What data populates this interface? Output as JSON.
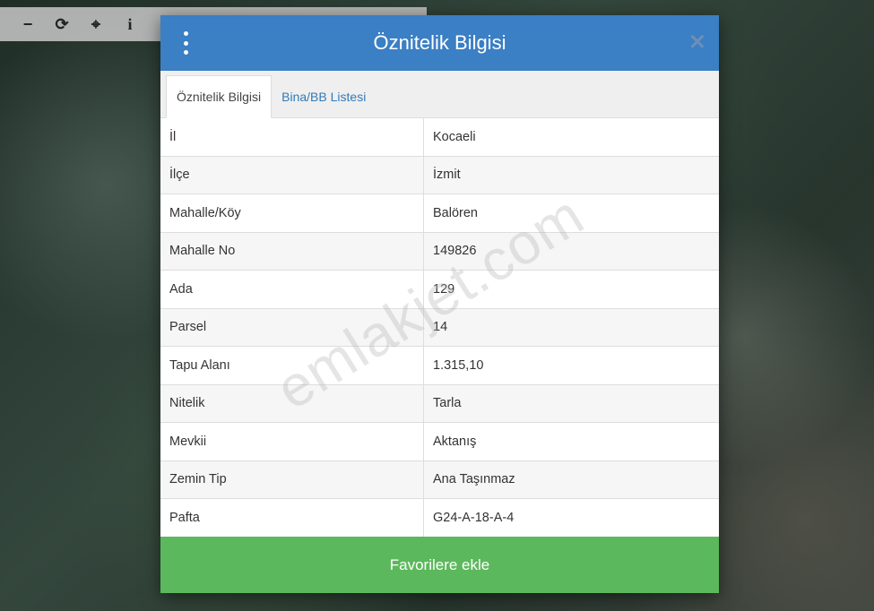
{
  "toolbar": {
    "buttons": [
      {
        "icon": "minus-icon",
        "glyph": "−"
      },
      {
        "icon": "refresh-icon",
        "glyph": "⟳"
      },
      {
        "icon": "crosshair-icon",
        "glyph": "⌖"
      },
      {
        "icon": "info-icon",
        "glyph": "i"
      }
    ]
  },
  "dialog": {
    "title": "Öznitelik Bilgisi",
    "close_glyph": "✕",
    "tabs": [
      "Öznitelik Bilgisi",
      "Bina/BB Listesi"
    ],
    "active_tab": "Öznitelik Bilgisi",
    "rows": [
      {
        "key": "İl",
        "value": "Kocaeli"
      },
      {
        "key": "İlçe",
        "value": "İzmit"
      },
      {
        "key": "Mahalle/Köy",
        "value": "Balören"
      },
      {
        "key": "Mahalle No",
        "value": "149826"
      },
      {
        "key": "Ada",
        "value": "129"
      },
      {
        "key": "Parsel",
        "value": "14"
      },
      {
        "key": "Tapu Alanı",
        "value": "1.315,10"
      },
      {
        "key": "Nitelik",
        "value": "Tarla"
      },
      {
        "key": "Mevkii",
        "value": "Aktanış"
      },
      {
        "key": "Zemin Tip",
        "value": "Ana Taşınmaz"
      },
      {
        "key": "Pafta",
        "value": "G24-A-18-A-4"
      }
    ],
    "favorite_button": "Favorilere ekle"
  },
  "watermark": "emlakjet.com",
  "colors": {
    "header": "#3b7fc4",
    "favorite": "#5cb85c",
    "tab_link": "#337ab7"
  }
}
